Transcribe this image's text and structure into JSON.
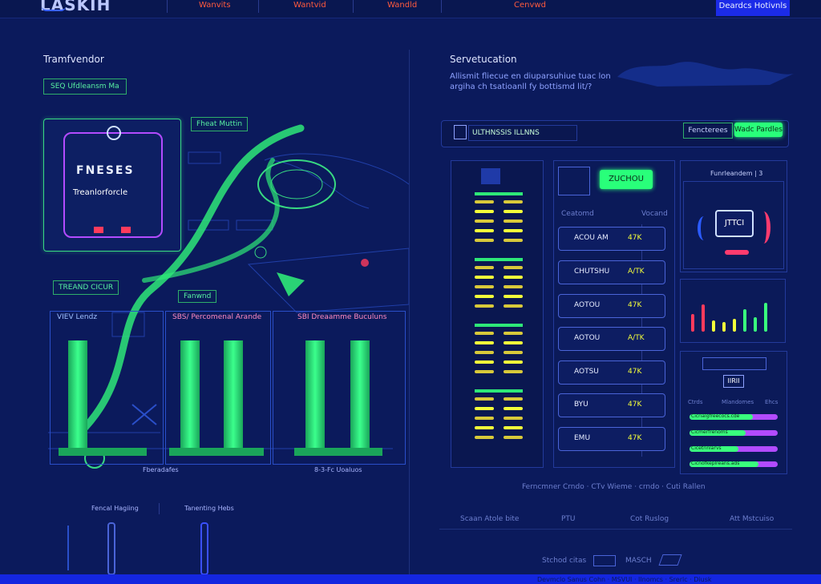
{
  "nav": {
    "logo": "LASKIH",
    "links": [
      "Wanvits",
      "Wantvid",
      "Wandld",
      "Cenvwd"
    ],
    "cta": "Deardcs Hotivnls"
  },
  "left": {
    "title": "Tramfvendor",
    "chip_top": "SEQ Ufdleansm Ma",
    "device_label_1": "FNESES",
    "device_label_2": "Treanlorforcle",
    "tag_1": "Fheat Muttin",
    "tag_2": "TREAND CICUR",
    "tag_3": "Fanwnd",
    "col_label_1": "VIEV Lendz",
    "col_label_2": "SBS/ Percomenal Arande",
    "col_label_3": "SBI Dreaamme Buculuns",
    "foot_1": "Fberadafes",
    "foot_2": "8-3-Fc Uoaluos",
    "legend_1": "Fencal Hagiing",
    "legend_2": "Tanenting Hebs"
  },
  "right": {
    "title": "Servetucation",
    "desc_1": "Allismit fliecue en diuparsuhiue tuac lon",
    "desc_2": "argiha ch tsatioanll fy bottismd lit/?",
    "search_value": "ULTHNSSIS ILLNNS",
    "btn_secondary": "Fencterees",
    "btn_primary": "Wadc Pardles",
    "action_btn": "ZUCHOU",
    "list_head_left": "Ceatomd",
    "list_head_right": "Vocand",
    "rows": [
      {
        "name": "ACOU AM",
        "val": "47K"
      },
      {
        "name": "CHUTSHU",
        "val": "A/TK"
      },
      {
        "name": "AOTOU",
        "val": "47K"
      },
      {
        "name": "AOTOU",
        "val": "A/TK"
      },
      {
        "name": "AOTSU",
        "val": "47K"
      },
      {
        "name": "BYU",
        "val": "47K"
      },
      {
        "name": "EMU",
        "val": "47K"
      }
    ],
    "panel_top_title": "Funrleandem | 3",
    "gauge_value": "JTTCI",
    "chart_bars": [
      {
        "h": 0.55,
        "color": "#ff3b5c"
      },
      {
        "h": 0.85,
        "color": "#ff3b5c"
      },
      {
        "h": 0.35,
        "color": "#f3ff3a"
      },
      {
        "h": 0.3,
        "color": "#f3ff3a"
      },
      {
        "h": 0.4,
        "color": "#f3ff3a"
      },
      {
        "h": 0.7,
        "color": "#39ff7d"
      },
      {
        "h": 0.45,
        "color": "#39ff7d"
      },
      {
        "h": 0.9,
        "color": "#39ff7d"
      }
    ],
    "mini_label": "IIRII",
    "mini_cols": [
      "Ctrds",
      "Mlandomes",
      "Ehcs"
    ],
    "progress": [
      {
        "label": "Cicrialgfreecocs.cde",
        "value": 0.72
      },
      {
        "label": "Cicmerfrenoms",
        "value": 0.64
      },
      {
        "label": "Cicetrinlarvs",
        "value": 0.55
      },
      {
        "label": "Cicnofkeplreans.ads",
        "value": 0.78
      }
    ],
    "footer_meta": "Ferncmner  Crndo · CTv  Wieme  · crndo · Cuti  Rallen",
    "footer_cols": [
      "Scaan  Atole bite",
      "PTU",
      "Cot Ruslog",
      "Att Mstcuiso"
    ],
    "bottom_links": [
      "Stchod citas",
      "MASCH"
    ],
    "bottom_strip": "Devmclo  Sanus  Cohn  · MSVUI  · Ilnomcs  · Srerlc  · Diusk"
  }
}
